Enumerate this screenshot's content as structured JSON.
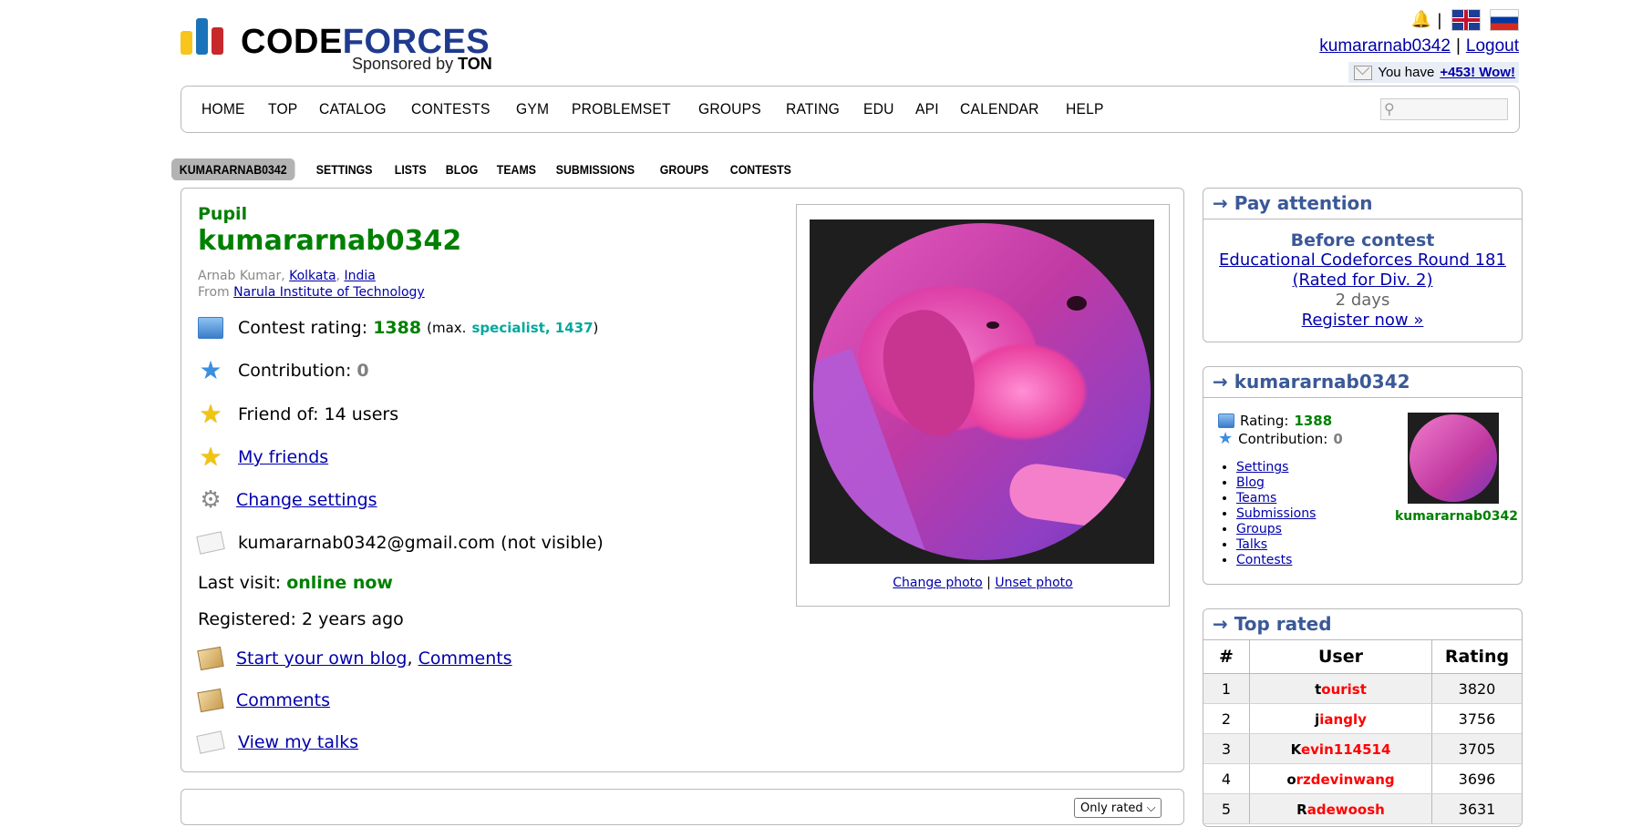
{
  "header": {
    "logo_code": "CODE",
    "logo_forces": "FORCES",
    "sponsored_prefix": "Sponsored by",
    "sponsored_by": "TON",
    "username_link": "kumararnab0342",
    "logout": "Logout",
    "mail_text": "You have",
    "mail_count": "+453! Wow!"
  },
  "menu": [
    "HOME",
    "TOP",
    "CATALOG",
    "CONTESTS",
    "GYM",
    "PROBLEMSET",
    "GROUPS",
    "RATING",
    "EDU",
    "API",
    "CALENDAR",
    "HELP"
  ],
  "submenu": [
    "KUMARARNAB0342",
    "SETTINGS",
    "LISTS",
    "BLOG",
    "TEAMS",
    "SUBMISSIONS",
    "GROUPS",
    "CONTESTS"
  ],
  "profile": {
    "rank": "Pupil",
    "handle": "kumararnab0342",
    "name": "Arnab Kumar,",
    "city": "Kolkata",
    "country": "India",
    "from_label": "From",
    "organization": "Narula Institute of Technology",
    "contest_rating_label": "Contest rating:",
    "contest_rating": "1388",
    "max_prefix": "(max.",
    "max_rank": "specialist, 1437",
    "max_suffix": ")",
    "contribution_label": "Contribution:",
    "contribution": "0",
    "friend_of": "Friend of: 14 users",
    "my_friends": "My friends",
    "change_settings": "Change settings",
    "email": "kumararnab0342@gmail.com (not visible)",
    "last_visit_label": "Last visit:",
    "last_visit": "online now",
    "registered": "Registered: 2 years ago",
    "start_blog": "Start your own blog",
    "comma": ",",
    "comments": "Comments",
    "comments2": "Comments",
    "view_talks": "View my talks",
    "change_photo": "Change photo",
    "unset_photo": "Unset photo",
    "photo_sep": "|",
    "only_rated": "Only rated ⌵"
  },
  "pay_attention": {
    "title": "→ Pay attention",
    "before": "Before contest",
    "contest": "Educational Codeforces Round 181 (Rated for Div. 2)",
    "days": "2 days",
    "register": "Register now »"
  },
  "user_box": {
    "title": "→ kumararnab0342",
    "rating_label": "Rating:",
    "rating": "1388",
    "contribution_label": "Contribution:",
    "contribution": "0",
    "links": [
      "Settings",
      "Blog",
      "Teams",
      "Submissions",
      "Groups",
      "Talks",
      "Contests"
    ],
    "name": "kumararnab0342"
  },
  "top_rated": {
    "title": "→ Top rated",
    "headers": [
      "#",
      "User",
      "Rating"
    ],
    "rows": [
      {
        "n": "1",
        "first": "t",
        "rest": "ourist",
        "rating": "3820"
      },
      {
        "n": "2",
        "first": "j",
        "rest": "iangly",
        "rating": "3756"
      },
      {
        "n": "3",
        "first": "K",
        "rest": "evin114514",
        "rating": "3705"
      },
      {
        "n": "4",
        "first": "o",
        "rest": "rzdevinwang",
        "rating": "3696"
      },
      {
        "n": "5",
        "first": "R",
        "rest": "adewoosh",
        "rating": "3631"
      }
    ]
  },
  "colors": {
    "pupil": "#008000",
    "specialist": "#03a89e",
    "legend": "#ff0000",
    "sidebar_title": "#3b5998"
  }
}
